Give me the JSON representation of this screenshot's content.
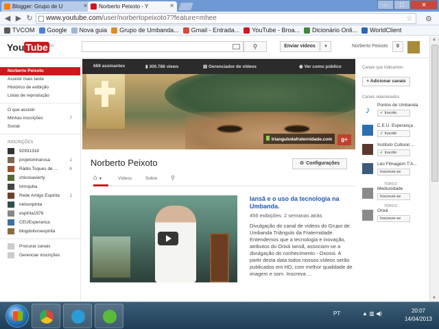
{
  "browser": {
    "tabs": [
      {
        "label": "Blogger: Grupo de U"
      },
      {
        "label": "Norberto Peixoto - Y"
      }
    ],
    "url_host": "www.youtube.com",
    "url_path": "/user/norbertopeixoto7?feature=mhee",
    "bookmarks": [
      {
        "label": "TVCOM",
        "color": "#5a5a5a"
      },
      {
        "label": "Google",
        "color": "#4a7fe0"
      },
      {
        "label": "Nova guia",
        "color": "#9fb6d6"
      },
      {
        "label": "Grupo de Umbanda...",
        "color": "#e08b2a"
      },
      {
        "label": "Gmail - Entrada...",
        "color": "#d44b37"
      },
      {
        "label": "YouTube - Broa...",
        "color": "#cc181e"
      },
      {
        "label": "Dicionário Onli...",
        "color": "#3c8a3c"
      },
      {
        "label": "WorldClient",
        "color": "#2a65b8"
      }
    ]
  },
  "youtube": {
    "logo_you": "You",
    "logo_tube": "Tube",
    "logo_region": "BR",
    "upload_label": "Enviar vídeos",
    "username": "Norberto Peixoto",
    "notifications": "0"
  },
  "sidebar": {
    "items": [
      {
        "label": "Norberto Peixoto"
      },
      {
        "label": "Assistir mais tarde"
      },
      {
        "label": "Histórico de exibição"
      },
      {
        "label": "Listas de reprodução"
      }
    ],
    "what_to_watch": [
      {
        "label": "O que assistir",
        "count": ""
      },
      {
        "label": "Minhas inscrições",
        "count": "7"
      },
      {
        "label": "Social",
        "count": ""
      }
    ],
    "subscriptions_heading": "INSCRIÇÕES",
    "subscriptions": [
      {
        "label": "92931318",
        "count": "",
        "color": "#333"
      },
      {
        "label": "projetoninarosa",
        "count": "1",
        "color": "#7c6a50"
      },
      {
        "label": "Rádio Toques de ...",
        "count": "6",
        "color": "#a0522d"
      },
      {
        "label": "chicoxavierty",
        "count": "",
        "color": "#556b2f"
      },
      {
        "label": "tvmojuba",
        "count": "",
        "color": "#444"
      },
      {
        "label": "Rede Amigo Espirita",
        "count": "1",
        "color": "#6b4226"
      },
      {
        "label": "nelsonpinta",
        "count": "",
        "color": "#2f4f4f"
      },
      {
        "label": "espirita1976",
        "count": "",
        "color": "#888"
      },
      {
        "label": "CEUEsperanca",
        "count": "",
        "color": "#3a6fa0"
      },
      {
        "label": "blogdolivroespirita",
        "count": "",
        "color": "#8b6b3d"
      }
    ],
    "footer": [
      {
        "label": "Procurar canais"
      },
      {
        "label": "Gerenciar inscrições"
      }
    ]
  },
  "channel": {
    "stats": {
      "subscribers": "669 assinantes",
      "views": "300.786 views",
      "manager": "Gerenciador de vídeos",
      "public_view": "Ver como público"
    },
    "banner_url": "triangulodafraternidade.com",
    "gplus": "g+",
    "name": "Norberto Peixoto",
    "config_label": "Configurações",
    "tabs": [
      {
        "label": "Vídeos"
      },
      {
        "label": "Sobre"
      }
    ]
  },
  "video": {
    "title": "Iansã e o uso da tecnologia na Umbanda.",
    "meta": "456 exibições. 2 semanas atrás",
    "description": "Divulgação do canal de vídeos do Grupo de Umbanda Triângulo da Fraternidade. Entendemos que a tecnologia e inovação, atributos do Orixá Iansã, associam-se a divulgação do conhecimento - Oxossi. A partir desta data todos nossos vídeos serão publicados em HD, com melhor qualidade de imagem e som. Inscreva ..."
  },
  "rightbar": {
    "liked_heading": "Canais que indicamos:",
    "add_channels": "+ Adicionar canais",
    "related_heading": "Canais relacionados",
    "related": [
      {
        "name": "Pontos de Umbanda",
        "topic": "",
        "button": "Inscrito",
        "subscribed": true,
        "color": "#3a85c9"
      },
      {
        "name": "C.E.U. Esperança",
        "topic": "",
        "button": "Inscrito",
        "subscribed": true,
        "color": "#2a6fb0"
      },
      {
        "name": "Instituto Cultural ...",
        "topic": "",
        "button": "Inscrito",
        "subscribed": true,
        "color": "#5a3a2a"
      },
      {
        "name": "Léo Filmagem T'A...",
        "topic": "",
        "button": "Inscrever-se",
        "subscribed": false,
        "color": "#3c5a7a"
      },
      {
        "name": "Mediunidade",
        "topic": "TÓPICO",
        "button": "Inscrever-se",
        "subscribed": false,
        "color": "#8a8a8a"
      },
      {
        "name": "Orixá",
        "topic": "TÓPICO",
        "button": "Inscrever-se",
        "subscribed": false,
        "color": "#8a8a8a"
      }
    ]
  },
  "taskbar": {
    "lang": "PT",
    "time": "20:07",
    "date": "14/04/2013",
    "apps": [
      {
        "name": "chrome",
        "color": "#d8453a"
      },
      {
        "name": "skype",
        "color": "#2b9bd6"
      },
      {
        "name": "icq",
        "color": "#5bbb3a"
      }
    ]
  }
}
